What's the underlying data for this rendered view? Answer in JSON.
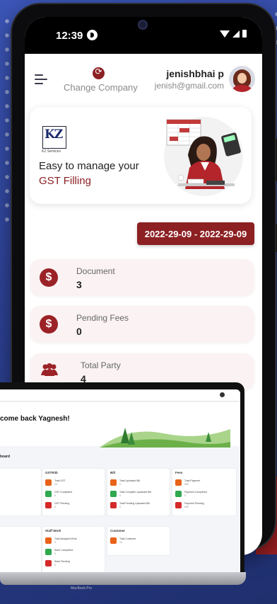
{
  "status_bar": {
    "time": "12:39"
  },
  "header": {
    "change_company_label": "Change Company",
    "user_name": "jenishbhai p",
    "user_email": "jenish@gmail.com"
  },
  "banner": {
    "logo_text": "KZ",
    "logo_subtext": "KZ Services",
    "tagline_line1": "Easy to manage your",
    "tagline_line2": "GST Filling"
  },
  "date_range": "2022-29-09 - 2022-29-09",
  "stats": [
    {
      "label": "Document",
      "value": "3",
      "icon": "dollar-icon"
    },
    {
      "label": "Pending Fees",
      "value": "0",
      "icon": "dollar-icon"
    },
    {
      "label": "Total Party",
      "value": "4",
      "icon": "people-icon"
    }
  ],
  "laptop": {
    "welcome": "come back Yagnesh!",
    "dashboard_label": "board",
    "model": "MacBook Pro",
    "panels": [
      {
        "title": "GSTR3b",
        "items": [
          {
            "label": "Total GST",
            "value": "10",
            "color": "#e8621a"
          },
          {
            "label": "GST Completed",
            "value": "0",
            "color": "#2fa84f"
          },
          {
            "label": "GST Pending",
            "value": "0",
            "color": "#d42a2a"
          }
        ]
      },
      {
        "title": "Bill",
        "items": [
          {
            "label": "Total Uploaded Bill",
            "value": "0",
            "color": "#e8621a"
          },
          {
            "label": "Total Complete Uploaded Bill",
            "value": "0",
            "color": "#2fa84f"
          },
          {
            "label": "Total Pending Uploaded Bill",
            "value": "0",
            "color": "#d42a2a"
          }
        ]
      },
      {
        "title": "Fees",
        "items": [
          {
            "label": "Total Payment",
            "value": "500",
            "color": "#e8621a"
          },
          {
            "label": "Payment Completed",
            "value": "0",
            "color": "#2fa84f"
          },
          {
            "label": "Payment Pending",
            "value": "500",
            "color": "#d42a2a"
          }
        ]
      },
      {
        "title": "Staff Work",
        "items": [
          {
            "label": "Total Assigned Work",
            "value": "0",
            "color": "#e8621a"
          },
          {
            "label": "Work Completed",
            "value": "0",
            "color": "#2fa84f"
          },
          {
            "label": "Work Pending",
            "value": "0",
            "color": "#d42a2a"
          }
        ]
      },
      {
        "title": "Customer",
        "items": [
          {
            "label": "Total Customer",
            "value": "10",
            "color": "#e8621a"
          }
        ]
      }
    ]
  }
}
